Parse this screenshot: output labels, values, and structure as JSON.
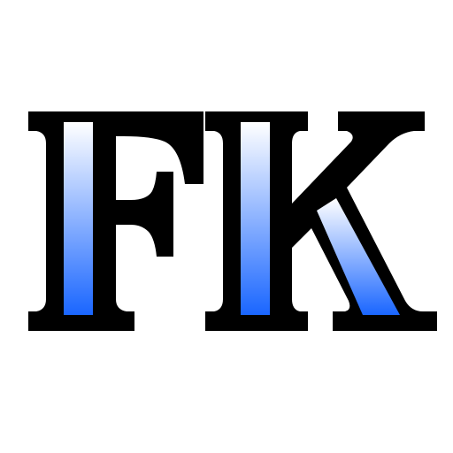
{
  "logo": {
    "text": "FK",
    "letters": [
      "F",
      "K"
    ],
    "colors": {
      "background": "#ffffff",
      "outline": "#000000",
      "gradient_top": "#ffffff",
      "gradient_bottom": "#1a66ff"
    }
  }
}
